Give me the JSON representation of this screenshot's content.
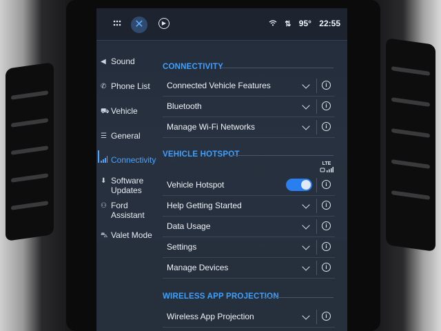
{
  "status_bar": {
    "temperature": "95°",
    "time": "22:55",
    "icons": [
      "apps-grid-icon",
      "close-icon",
      "media-play-icon",
      "wifi-icon",
      "data-arrows-icon"
    ]
  },
  "sidebar": {
    "items": [
      {
        "label": "Sound",
        "icon": "speaker-icon"
      },
      {
        "label": "Phone List",
        "icon": "phone-icon"
      },
      {
        "label": "Vehicle",
        "icon": "car-icon"
      },
      {
        "label": "General",
        "icon": "sliders-icon"
      },
      {
        "label": "Connectivity",
        "icon": "signal-bars-icon",
        "active": true
      },
      {
        "label": "Software\nUpdates",
        "icon": "download-icon"
      },
      {
        "label": "Ford\nAssistant",
        "icon": "assistant-icon"
      },
      {
        "label": "Valet Mode",
        "icon": "valet-car-icon"
      }
    ]
  },
  "main": {
    "sections": [
      {
        "title": "CONNECTIVITY",
        "rows": [
          {
            "label": "Connected Vehicle Features",
            "control": "chevron"
          },
          {
            "label": "Bluetooth",
            "control": "chevron"
          },
          {
            "label": "Manage Wi-Fi Networks",
            "control": "chevron"
          }
        ]
      },
      {
        "title": "VEHICLE HOTSPOT",
        "badge": "LTE",
        "rows": [
          {
            "label": "Vehicle Hotspot",
            "control": "toggle",
            "toggle_on": true
          },
          {
            "label": "Help Getting Started",
            "control": "chevron"
          },
          {
            "label": "Data Usage",
            "control": "chevron"
          },
          {
            "label": "Settings",
            "control": "chevron"
          },
          {
            "label": "Manage Devices",
            "control": "chevron"
          }
        ]
      },
      {
        "title": "WIRELESS APP PROJECTION",
        "rows": [
          {
            "label": "Wireless App Projection",
            "control": "chevron"
          }
        ]
      }
    ]
  },
  "colors": {
    "accent": "#3ea0ff",
    "toggle_on": "#2a7ff0",
    "screen_bg": "#262f3c"
  }
}
